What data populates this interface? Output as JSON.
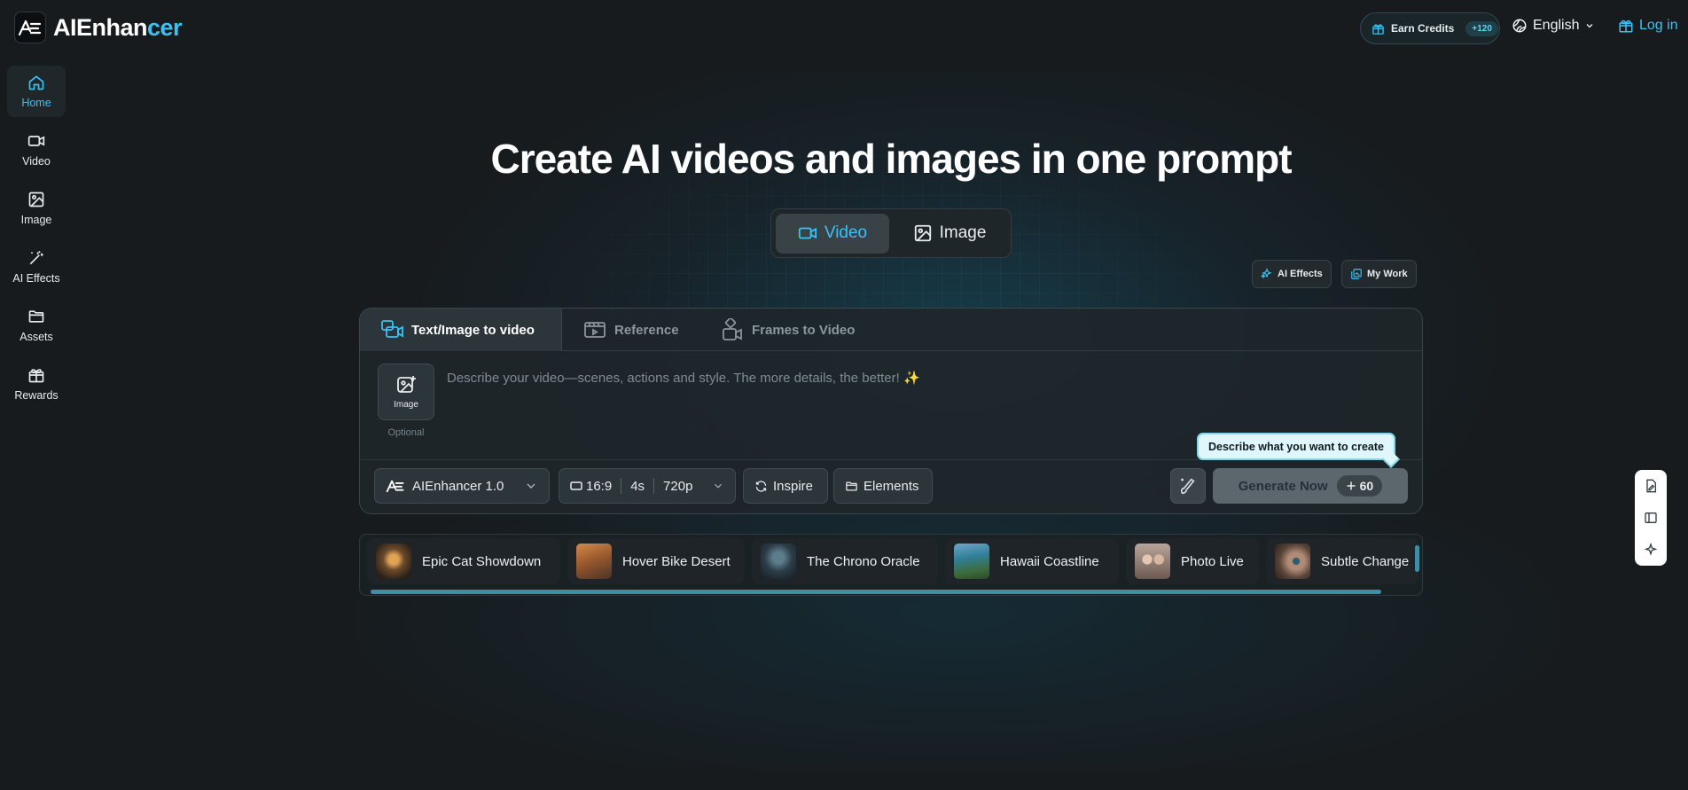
{
  "brand": {
    "name_part1": "AIEnhan",
    "name_part2": "cer"
  },
  "header": {
    "earn_credits": "Earn Credits",
    "earn_badge": "+120",
    "language": "English",
    "login": "Log in"
  },
  "sidebar": {
    "items": [
      {
        "label": "Home",
        "icon": "home-icon",
        "active": true
      },
      {
        "label": "Video",
        "icon": "video-icon"
      },
      {
        "label": "Image",
        "icon": "image-icon"
      },
      {
        "label": "AI Effects",
        "icon": "magic-wand-icon"
      },
      {
        "label": "Assets",
        "icon": "folder-icon"
      },
      {
        "label": "Rewards",
        "icon": "gift-icon"
      }
    ]
  },
  "hero": {
    "title": "Create AI videos and images in one prompt",
    "modes": [
      {
        "label": "Video",
        "active": true
      },
      {
        "label": "Image"
      }
    ],
    "ai_effects": "AI Effects",
    "my_work": "My Work"
  },
  "card": {
    "tabs": [
      {
        "label": "Text/Image to video",
        "active": true
      },
      {
        "label": "Reference"
      },
      {
        "label": "Frames to Video"
      }
    ],
    "upload_label": "Image",
    "upload_hint": "Optional",
    "prompt_placeholder": "Describe your video—scenes, actions and style. The more details, the better! ✨",
    "model": "AIEnhancer 1.0",
    "aspect": "16:9",
    "duration": "4s",
    "resolution": "720p",
    "inspire": "Inspire",
    "elements": "Elements",
    "generate": "Generate Now",
    "cost": "60",
    "tooltip": "Describe what you want to create"
  },
  "showcase": [
    {
      "label": "Epic Cat Showdown"
    },
    {
      "label": "Hover Bike Desert"
    },
    {
      "label": "The Chrono Oracle"
    },
    {
      "label": "Hawaii Coastline"
    },
    {
      "label": "Photo Live"
    },
    {
      "label": "Subtle Change"
    }
  ],
  "colors": {
    "accent": "#3bc2f5",
    "background": "#171b1e",
    "card": "#1e262a"
  }
}
